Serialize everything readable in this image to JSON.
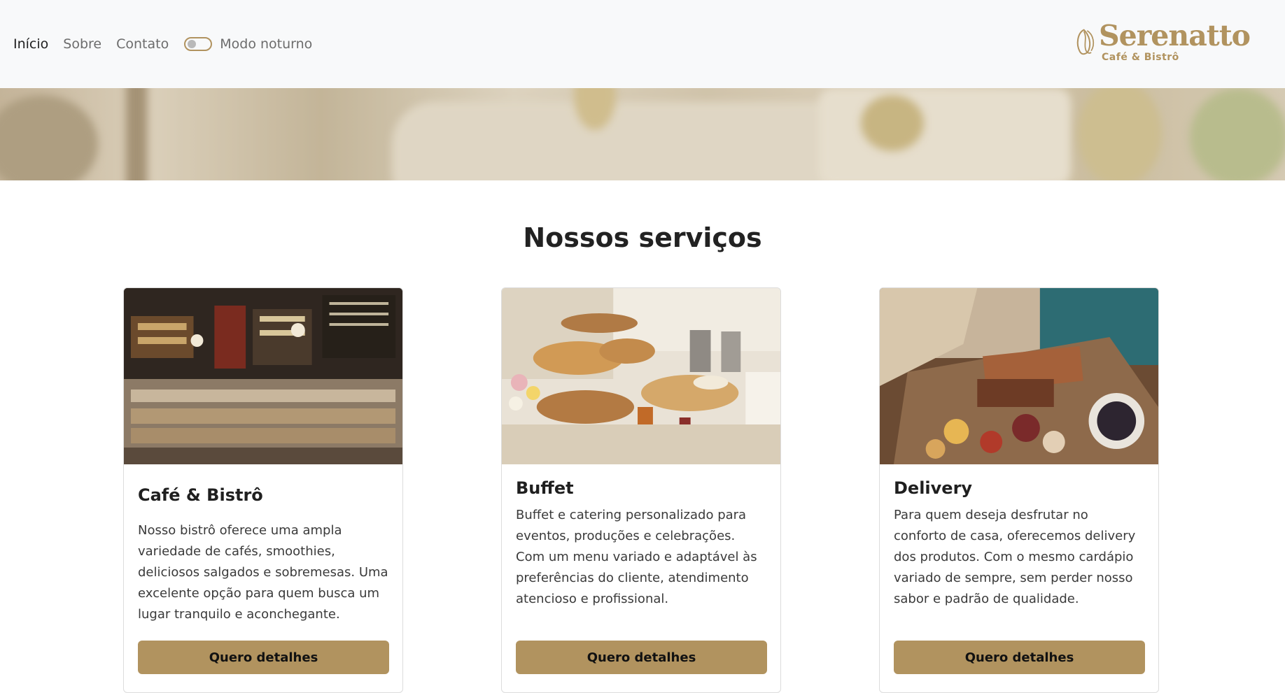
{
  "nav": {
    "links": [
      {
        "label": "Início"
      },
      {
        "label": "Sobre"
      },
      {
        "label": "Contato"
      }
    ],
    "dark_mode_label": "Modo noturno",
    "dark_mode_on": false
  },
  "brand": {
    "name": "Serenatto",
    "subtitle": "Café & Bistrô",
    "color": "#b1935f"
  },
  "section": {
    "title": "Nossos serviços"
  },
  "cards": [
    {
      "title": "Café & Bistrô",
      "text": "Nosso bistrô oferece uma ampla variedade de cafés, smoothies, deliciosos salgados e sobremesas. Uma excelente opção para quem busca um lugar tranquilo e aconchegante.",
      "button": "Quero detalhes"
    },
    {
      "title": "Buffet",
      "text": "Buffet e catering personalizado para eventos, produções e celebrações. Com um menu variado e adaptável às preferências do cliente, atendimento atencioso e profissional.",
      "button": "Quero detalhes"
    },
    {
      "title": "Delivery",
      "text": "Para quem deseja desfrutar no conforto de casa, oferecemos delivery dos produtos. Com o mesmo cardápio variado de sempre, sem perder nosso sabor e padrão de qualidade.",
      "button": "Quero detalhes"
    }
  ],
  "colors": {
    "accent": "#b1935f",
    "header_bg": "#f8f9fa"
  }
}
